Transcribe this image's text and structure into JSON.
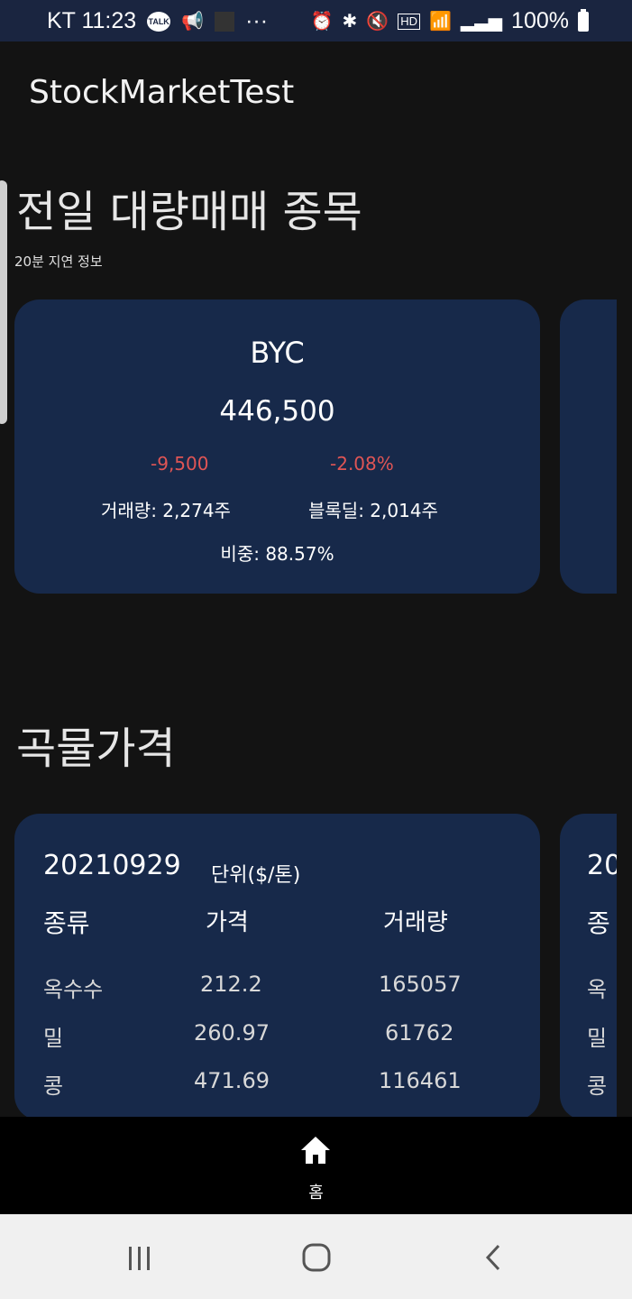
{
  "status_bar": {
    "carrier_time": "KT 11:23",
    "talk": "TALK",
    "battery": "100%",
    "more": "···"
  },
  "app": {
    "title": "StockMarketTest"
  },
  "block_trades": {
    "title": "전일 대량매매 종목",
    "subtitle": "20분 지연 정보",
    "card": {
      "name": "BYC",
      "price": "446,500",
      "change": "-9,500",
      "change_pct": "-2.08%",
      "volume": "거래량: 2,274주",
      "block_deal": "블록딜: 2,014주",
      "ratio": "비중: 88.57%"
    },
    "colors": {
      "card": "#17294a",
      "negative": "#e05555"
    }
  },
  "grains": {
    "title": "곡물가격",
    "card": {
      "date": "20210929",
      "unit": "단위($/톤)",
      "headers": [
        "종류",
        "가격",
        "거래량"
      ],
      "rows": [
        [
          "옥수수",
          "212.2",
          "165057"
        ],
        [
          "밀",
          "260.97",
          "61762"
        ],
        [
          "콩",
          "471.69",
          "116461"
        ]
      ]
    },
    "next_card_peek": {
      "date": "20",
      "header": "종",
      "rows": [
        "옥",
        "밀",
        "콩"
      ]
    }
  },
  "bottom_nav": {
    "home_label": "홈"
  }
}
